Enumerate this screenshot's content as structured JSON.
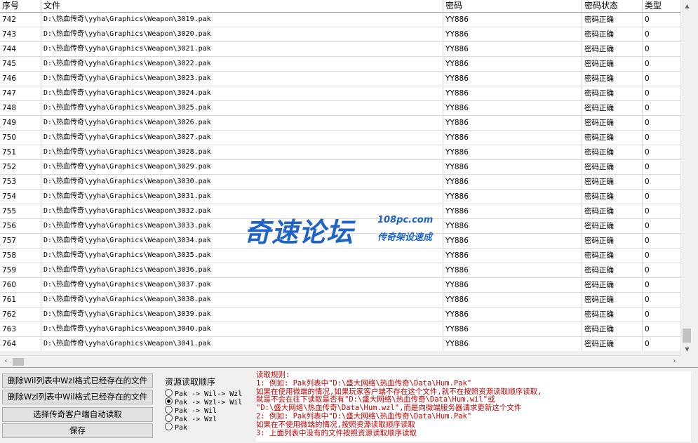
{
  "table": {
    "headers": [
      "序号",
      "文件",
      "密码",
      "密码状态",
      "类型"
    ],
    "rows": [
      [
        "742",
        "D:\\热血传奇\\yyha\\Graphics\\Weapon\\3019.pak",
        "YY886",
        "密码正确",
        "0"
      ],
      [
        "743",
        "D:\\热血传奇\\yyha\\Graphics\\Weapon\\3020.pak",
        "YY886",
        "密码正确",
        "0"
      ],
      [
        "744",
        "D:\\热血传奇\\yyha\\Graphics\\Weapon\\3021.pak",
        "YY886",
        "密码正确",
        "0"
      ],
      [
        "745",
        "D:\\热血传奇\\yyha\\Graphics\\Weapon\\3022.pak",
        "YY886",
        "密码正确",
        "0"
      ],
      [
        "746",
        "D:\\热血传奇\\yyha\\Graphics\\Weapon\\3023.pak",
        "YY886",
        "密码正确",
        "0"
      ],
      [
        "747",
        "D:\\热血传奇\\yyha\\Graphics\\Weapon\\3024.pak",
        "YY886",
        "密码正确",
        "0"
      ],
      [
        "748",
        "D:\\热血传奇\\yyha\\Graphics\\Weapon\\3025.pak",
        "YY886",
        "密码正确",
        "0"
      ],
      [
        "749",
        "D:\\热血传奇\\yyha\\Graphics\\Weapon\\3026.pak",
        "YY886",
        "密码正确",
        "0"
      ],
      [
        "750",
        "D:\\热血传奇\\yyha\\Graphics\\Weapon\\3027.pak",
        "YY886",
        "密码正确",
        "0"
      ],
      [
        "751",
        "D:\\热血传奇\\yyha\\Graphics\\Weapon\\3028.pak",
        "YY886",
        "密码正确",
        "0"
      ],
      [
        "752",
        "D:\\热血传奇\\yyha\\Graphics\\Weapon\\3029.pak",
        "YY886",
        "密码正确",
        "0"
      ],
      [
        "753",
        "D:\\热血传奇\\yyha\\Graphics\\Weapon\\3030.pak",
        "YY886",
        "密码正确",
        "0"
      ],
      [
        "754",
        "D:\\热血传奇\\yyha\\Graphics\\Weapon\\3031.pak",
        "YY886",
        "密码正确",
        "0"
      ],
      [
        "755",
        "D:\\热血传奇\\yyha\\Graphics\\Weapon\\3032.pak",
        "YY886",
        "密码正确",
        "0"
      ],
      [
        "756",
        "D:\\热血传奇\\yyha\\Graphics\\Weapon\\3033.pak",
        "YY886",
        "密码正确",
        "0"
      ],
      [
        "757",
        "D:\\热血传奇\\yyha\\Graphics\\Weapon\\3034.pak",
        "YY886",
        "密码正确",
        "0"
      ],
      [
        "758",
        "D:\\热血传奇\\yyha\\Graphics\\Weapon\\3035.pak",
        "YY886",
        "密码正确",
        "0"
      ],
      [
        "759",
        "D:\\热血传奇\\yyha\\Graphics\\Weapon\\3036.pak",
        "YY886",
        "密码正确",
        "0"
      ],
      [
        "760",
        "D:\\热血传奇\\yyha\\Graphics\\Weapon\\3037.pak",
        "YY886",
        "密码正确",
        "0"
      ],
      [
        "761",
        "D:\\热血传奇\\yyha\\Graphics\\Weapon\\3038.pak",
        "YY886",
        "密码正确",
        "0"
      ],
      [
        "762",
        "D:\\热血传奇\\yyha\\Graphics\\Weapon\\3039.pak",
        "YY886",
        "密码正确",
        "0"
      ],
      [
        "763",
        "D:\\热血传奇\\yyha\\Graphics\\Weapon\\3040.pak",
        "YY886",
        "密码正确",
        "0"
      ],
      [
        "764",
        "D:\\热血传奇\\yyha\\Graphics\\Weapon\\3041.pak",
        "YY886",
        "密码正确",
        "0"
      ]
    ]
  },
  "buttons": {
    "delete_wil": "删除Wil列表中Wzl格式已经存在的文件",
    "delete_wzl": "删除Wzl列表中Wil格式已经存在的文件",
    "auto_read": "选择传奇客户端自动读取",
    "save": "保存"
  },
  "resource_order": {
    "title": "资源读取顺序",
    "options": [
      "Pak -> Wil-> Wzl",
      "Pak -> Wzl-> Wil",
      "Pak -> Wil",
      "Pak -> Wzl",
      "Pak"
    ],
    "selected_index": 1
  },
  "rules": {
    "lines": [
      "读取规则:",
      "1: 例如: Pak列表中\"D:\\盛大网络\\热血传奇\\Data\\Hum.Pak\"",
      "    如果在使用微端的情况,如果玩家客户端不存在这个文件,就不在按照资源读取顺序读取,",
      "    就是不会在往下读取是否有\"D:\\盛大网络\\热血传奇\\Data\\Hum.wil\"或",
      "   \"D:\\盛大网络\\热血传奇\\Data\\Hum.wzl\",而是向微端服务器请求更新这个文件",
      "2: 例如: Pak列表中\"D:\\盛大网络\\热血传奇\\Data\\Hum.Pak\"",
      "    如果在不使用微端的情况,按照资源读取顺序读取",
      "3: 上面列表中没有的文件按照资源读取顺序读取"
    ]
  },
  "watermark": {
    "main": "奇速论坛",
    "url": "108pc.com",
    "sub": "传奇架设速成"
  },
  "colors": {
    "rules_text": "#c00000",
    "watermark": "#1f63c7"
  }
}
